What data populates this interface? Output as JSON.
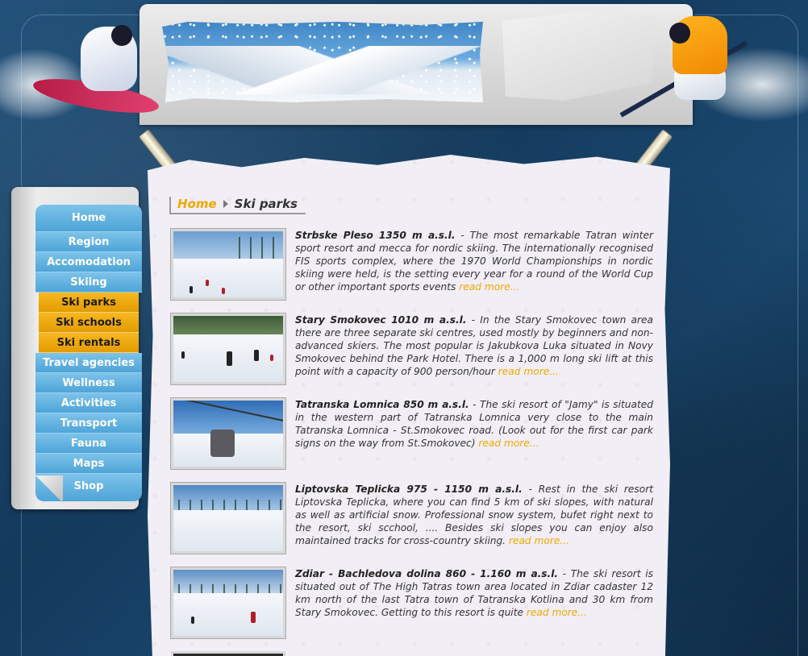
{
  "nav": {
    "items": [
      {
        "label": "Home"
      },
      {
        "label": "Region"
      },
      {
        "label": "Accomodation"
      },
      {
        "label": "Skiing"
      },
      {
        "label": "Ski parks"
      },
      {
        "label": "Ski schools"
      },
      {
        "label": "Ski rentals"
      },
      {
        "label": "Travel agencies"
      },
      {
        "label": "Wellness"
      },
      {
        "label": "Activities"
      },
      {
        "label": "Transport"
      },
      {
        "label": "Fauna"
      },
      {
        "label": "Maps"
      },
      {
        "label": "Shop"
      }
    ],
    "active_color": "#f0a800",
    "item_color": "#5aaedf"
  },
  "breadcrumb": {
    "home": "Home",
    "current": "Ski parks"
  },
  "articles": [
    {
      "title": "Strbske Pleso 1350 m a.s.l.",
      "sep": " - ",
      "text": "The most remarkable Tatran winter sport resort and mecca for nordic skiing. The internationally recognised FIS sports complex, where the 1970 World Championships in nordic skiing were held, is the setting every year for a round of the World Cup or other important sports events",
      "read_more": "read more..."
    },
    {
      "title": "Stary Smokovec 1010 m a.s.l.",
      "sep": " - ",
      "text": "In the Stary Smokovec town area there are three separate ski centres, used mostly by beginners and non-advanced skiers. The most popular is Jakubkova Luka situated in Novy Smokovec behind the Park Hotel. There is a 1,000 m long ski lift at this point with a capacity of 900 person/hour",
      "read_more": "read more..."
    },
    {
      "title": "Tatranska Lomnica 850 m a.s.l.",
      "sep": " - ",
      "text": "The ski resort of \"Jamy\" is situated in the western part of Tatranska Lomnica very close to the main Tatranska Lomnica - St.Smokovec road. (Look out for the first car park signs on the way from St.Smokovec)",
      "read_more": "read more..."
    },
    {
      "title": "Liptovska Teplicka 975 - 1150 m a.s.l.",
      "sep": " - ",
      "text": "Rest in the ski resort Liptovska Teplicka, where you can find 5 km of ski slopes, with natural as well as artificial snow. Professional snow system, bufet right next to the resort, ski scchool, .... Besides ski slopes you can enjoy also maintained tracks for cross-country skiing.",
      "read_more": "read more..."
    },
    {
      "title": "Zdiar - Bachledova dolina 860 - 1.160 m a.s.l.",
      "sep": " - ",
      "text": "The ski resort is situated out of The High Tatras town area located in Zdiar cadaster 12 km north of the last Tatra town of Tatranska Kotlina and 30 km from Stary Smokovec. Getting to this resort is quite",
      "read_more": "read more..."
    }
  ]
}
